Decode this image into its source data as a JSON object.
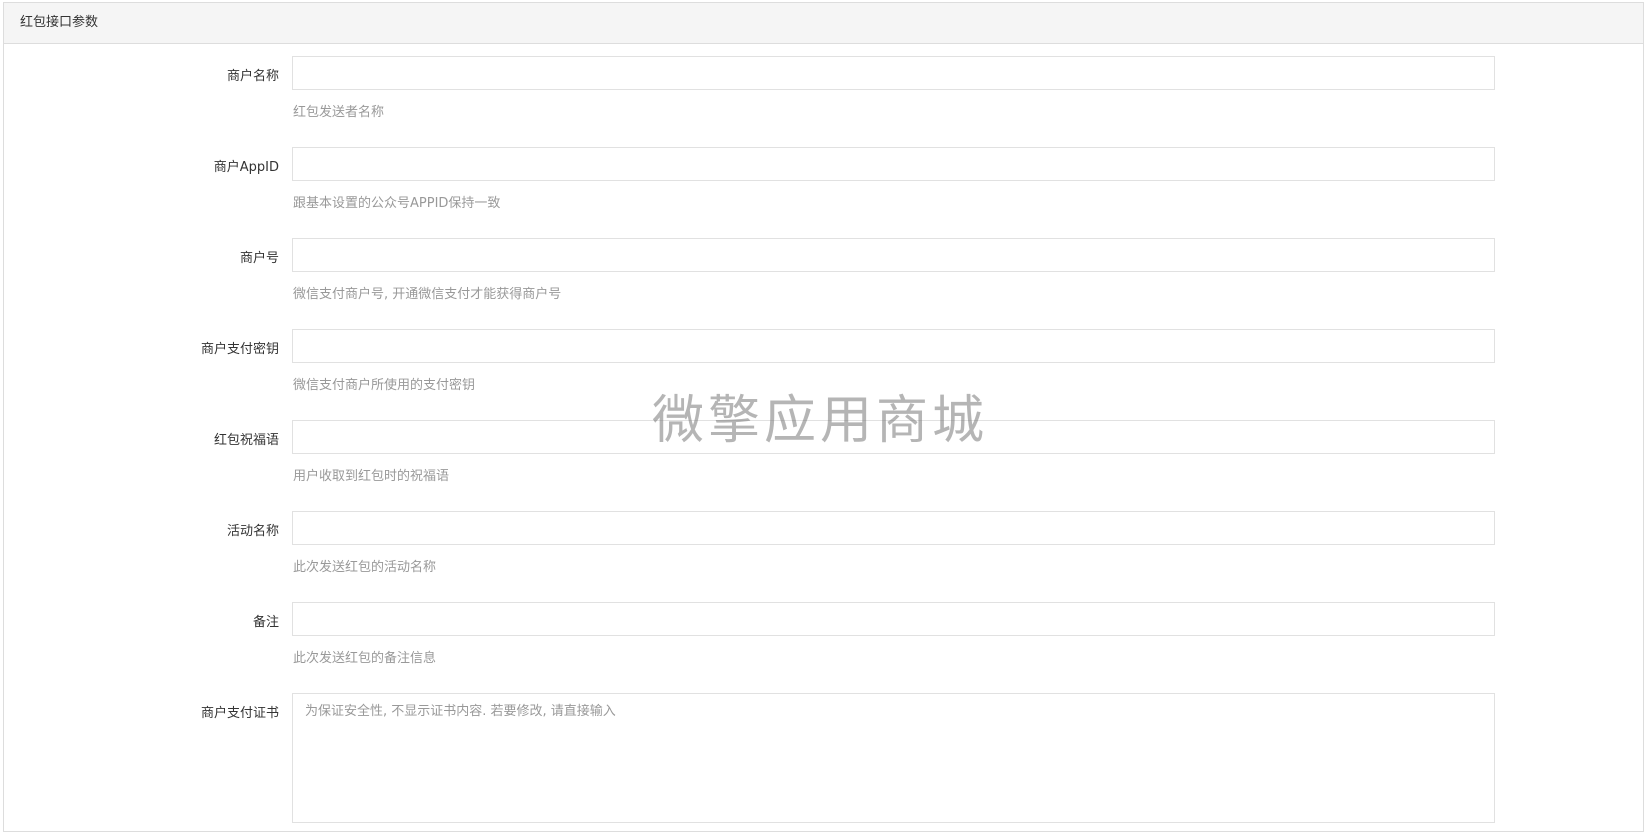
{
  "panel": {
    "title": "红包接口参数"
  },
  "fields": [
    {
      "label": "商户名称",
      "value": "",
      "help": "红包发送者名称"
    },
    {
      "label": "商户AppID",
      "value": "",
      "help": "跟基本设置的公众号APPID保持一致"
    },
    {
      "label": "商户号",
      "value": "",
      "help": "微信支付商户号, 开通微信支付才能获得商户号"
    },
    {
      "label": "商户支付密钥",
      "value": "",
      "help": "微信支付商户所使用的支付密钥"
    },
    {
      "label": "红包祝福语",
      "value": "",
      "help": "用户收取到红包时的祝福语"
    },
    {
      "label": "活动名称",
      "value": "",
      "help": "此次发送红包的活动名称"
    },
    {
      "label": "备注",
      "value": "",
      "help": "此次发送红包的备注信息"
    }
  ],
  "certificate": {
    "label": "商户支付证书",
    "value": "",
    "placeholder": "为保证安全性, 不显示证书内容. 若要修改, 请直接输入"
  },
  "watermark": "微擎应用商城"
}
